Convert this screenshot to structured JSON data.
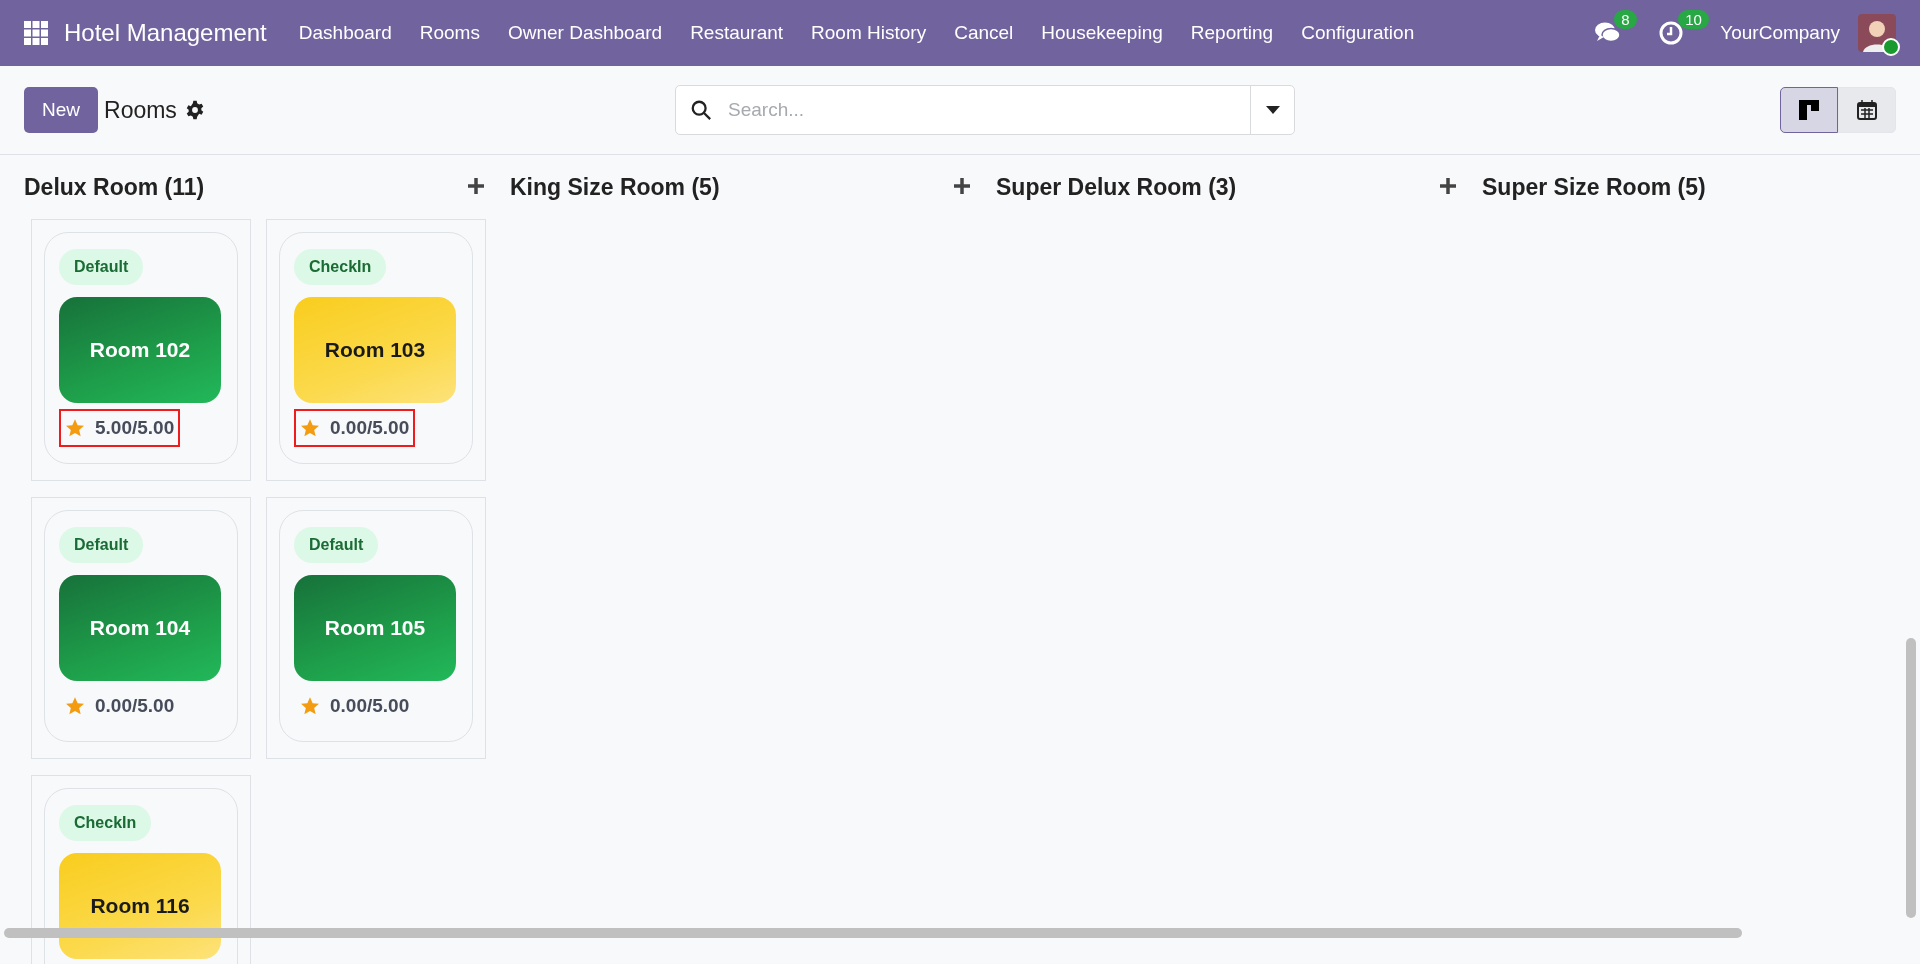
{
  "navbar": {
    "app_title": "Hotel Management",
    "menu": [
      "Dashboard",
      "Rooms",
      "Owner Dashboard",
      "Restaurant",
      "Room History",
      "Cancel",
      "Housekeeping",
      "Reporting",
      "Configuration"
    ],
    "messages_count": "8",
    "activities_count": "10",
    "company": "YourCompany",
    "online": true
  },
  "control_panel": {
    "new_button": "New",
    "breadcrumb": "Rooms",
    "search": {
      "placeholder": "Search..."
    },
    "views": [
      {
        "kind": "kanban",
        "selected": true
      },
      {
        "kind": "calendar",
        "selected": false
      }
    ]
  },
  "columns": [
    {
      "title": "Delux Room (11)",
      "cards": [
        {
          "tag": "Default",
          "room": "Room 102",
          "kind": "default",
          "rating": "5.00/5.00",
          "highlighted": true
        },
        {
          "tag": "CheckIn",
          "room": "Room 103",
          "kind": "checkin",
          "rating": "0.00/5.00",
          "highlighted": true
        },
        {
          "tag": "Default",
          "room": "Room 104",
          "kind": "default",
          "rating": "0.00/5.00",
          "highlighted": false
        },
        {
          "tag": "Default",
          "room": "Room 105",
          "kind": "default",
          "rating": "0.00/5.00",
          "highlighted": false
        },
        {
          "tag": "CheckIn",
          "room": "Room 116",
          "kind": "checkin"
        }
      ]
    },
    {
      "title": "King Size Room (5)"
    },
    {
      "title": "Super Delux Room (3)"
    },
    {
      "title": "Super Size Room (5)"
    }
  ]
}
